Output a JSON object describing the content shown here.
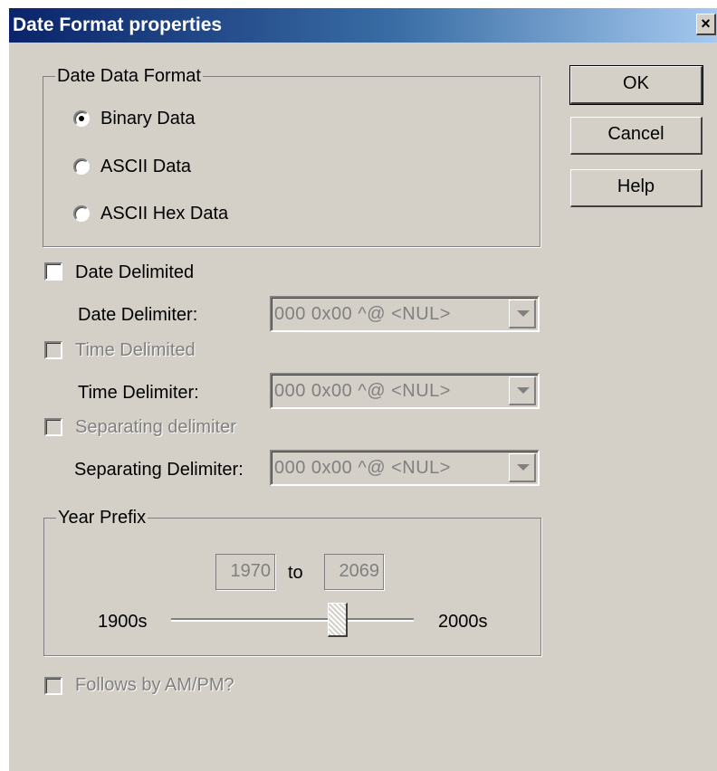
{
  "window": {
    "title": "Date Format properties",
    "close_label": "×"
  },
  "buttons": {
    "ok": "OK",
    "cancel": "Cancel",
    "help": "Help"
  },
  "date_data_format": {
    "legend": "Date Data Format",
    "options": [
      {
        "label": "Binary Data",
        "selected": true
      },
      {
        "label": "ASCII Data",
        "selected": false
      },
      {
        "label": "ASCII Hex Data",
        "selected": false
      }
    ]
  },
  "date_delimited": {
    "label": "Date Delimited",
    "checked": false,
    "enabled": true
  },
  "date_delimiter": {
    "label": "Date Delimiter:",
    "value": "000  0x00  ^@  <NUL>",
    "enabled": false
  },
  "time_delimited": {
    "label": "Time Delimited",
    "checked": false,
    "enabled": false
  },
  "time_delimiter": {
    "label": "Time Delimiter:",
    "value": "000  0x00  ^@  <NUL>",
    "enabled": false
  },
  "separating_delimited": {
    "label": "Separating delimiter",
    "checked": false,
    "enabled": false
  },
  "separating_delimiter": {
    "label": "Separating Delimiter:",
    "value": "000  0x00  ^@  <NUL>",
    "enabled": false
  },
  "year_prefix": {
    "legend": "Year Prefix",
    "from": "1970",
    "to_label": "to",
    "to": "2069",
    "min_label": "1900s",
    "max_label": "2000s",
    "slider_fraction": 0.7
  },
  "follows_ampm": {
    "label": "Follows by AM/PM?",
    "checked": false,
    "enabled": false
  }
}
